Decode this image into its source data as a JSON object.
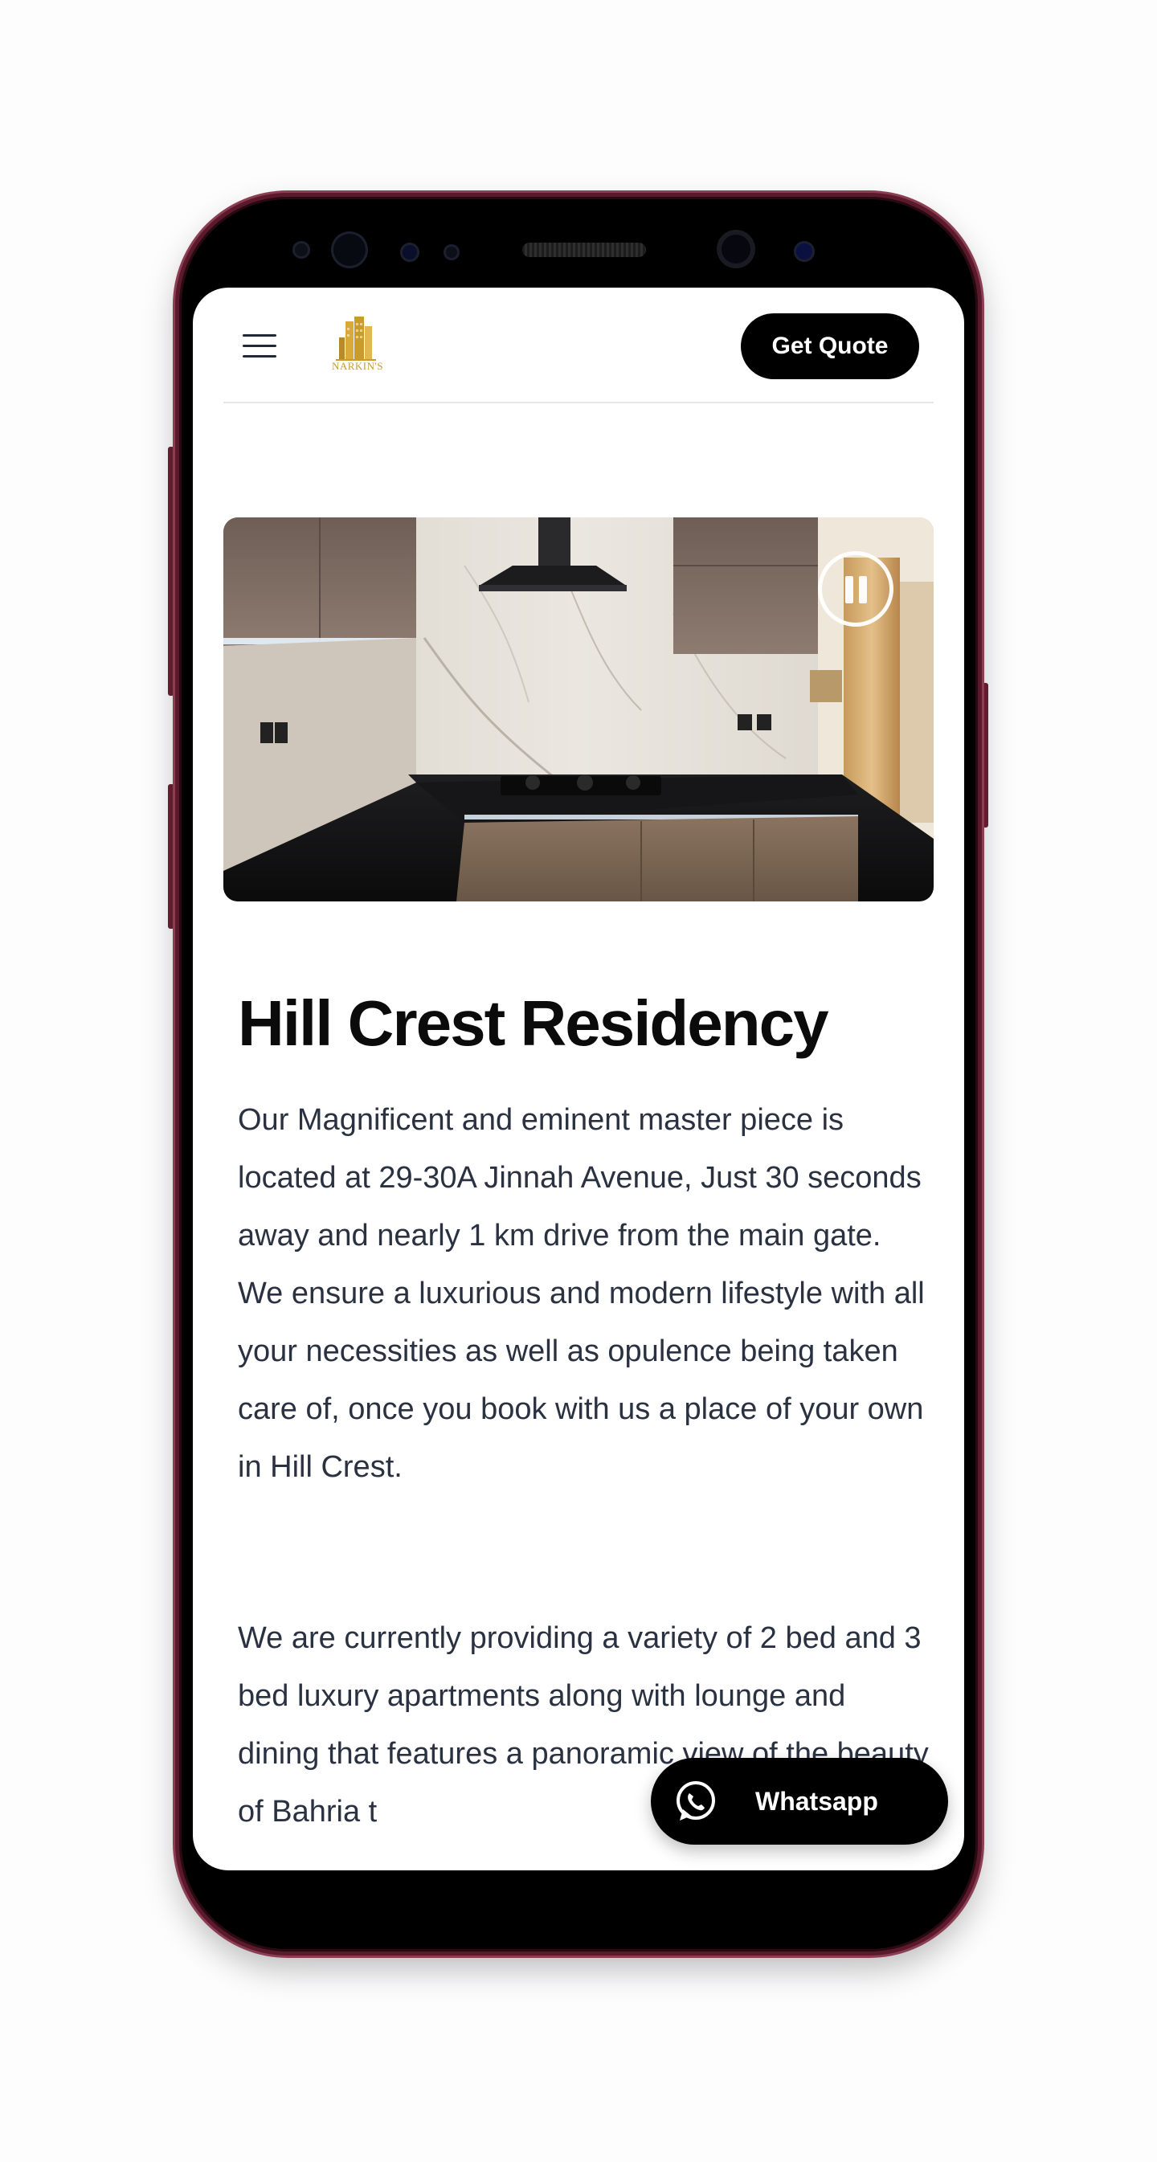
{
  "header": {
    "menu_icon": "hamburger-menu-icon",
    "logo_text": "NARKIN'S",
    "quote_label": "Get Quote"
  },
  "hero": {
    "pause_icon": "pause-icon",
    "image_subject": "kitchen"
  },
  "content": {
    "title": "Hill Crest Residency",
    "paragraph_1": "Our Magnificent and eminent master piece is located at 29-30A Jinnah Avenue, Just 30 seconds away and nearly 1 km drive from the main gate. We ensure a luxurious and modern lifestyle with all your necessities as well as opulence being taken care of, once you book with us a place of your own in Hill Crest.",
    "paragraph_2": "We are currently providing a variety of 2 bed and 3 bed luxury apartments along with lounge and dining that features a panoramic view of the beauty of Bahria t"
  },
  "floating": {
    "whatsapp_label": "Whatsapp",
    "whatsapp_icon": "whatsapp-icon"
  },
  "colors": {
    "brand_gold": "#c99a2e",
    "frame": "#5a1a2c",
    "button_bg": "#000000",
    "text": "#2a3140"
  }
}
